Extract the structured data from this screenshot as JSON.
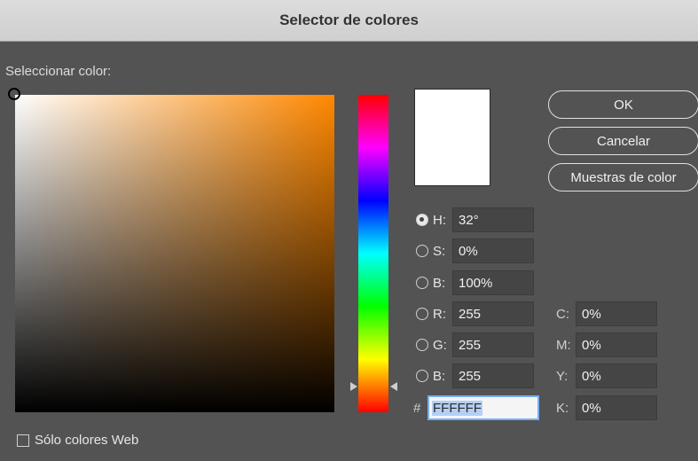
{
  "window": {
    "title": "Selector de colores"
  },
  "picker": {
    "label": "Seleccionar color:"
  },
  "buttons": {
    "ok": "OK",
    "cancel": "Cancelar",
    "swatches": "Muestras de color"
  },
  "hsb": [
    {
      "key": "h",
      "label": "H:",
      "value": "32°",
      "selected": true
    },
    {
      "key": "s",
      "label": "S:",
      "value": "0%",
      "selected": false
    },
    {
      "key": "b",
      "label": "B:",
      "value": "100%",
      "selected": false
    }
  ],
  "rgb": [
    {
      "key": "r",
      "label": "R:",
      "value": "255",
      "selected": false
    },
    {
      "key": "g",
      "label": "G:",
      "value": "255",
      "selected": false
    },
    {
      "key": "b",
      "label": "B:",
      "value": "255",
      "selected": false
    }
  ],
  "hex": {
    "label": "#",
    "value": "FFFFFF"
  },
  "cmyk": [
    {
      "label": "C:",
      "value": "0%"
    },
    {
      "label": "M:",
      "value": "0%"
    },
    {
      "label": "Y:",
      "value": "0%"
    },
    {
      "label": "K:",
      "value": "0%"
    }
  ],
  "web_only": {
    "label": "Sólo colores Web",
    "checked": false
  },
  "colors": {
    "current": "#FFFFFF",
    "hue_field": "#FF8800",
    "background": "#535353",
    "hex_focus": "#79AEF2"
  }
}
